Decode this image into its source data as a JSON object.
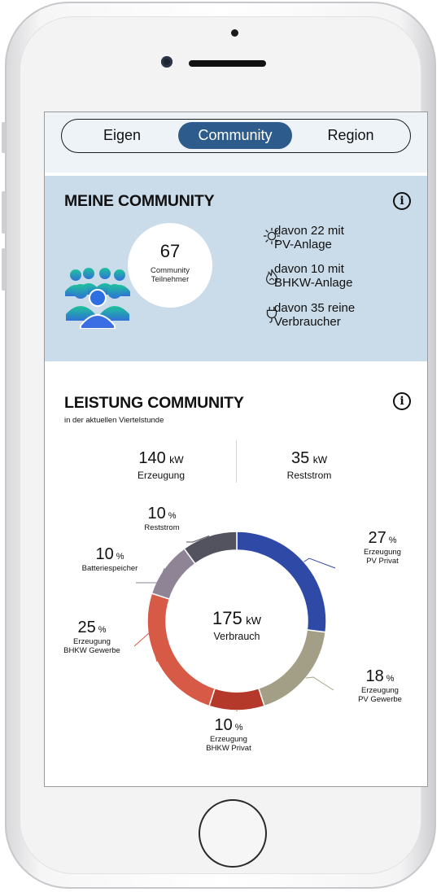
{
  "tabs": [
    {
      "label": "Eigen",
      "active": false
    },
    {
      "label": "Community",
      "active": true
    },
    {
      "label": "Region",
      "active": false
    }
  ],
  "community": {
    "title": "MEINE COMMUNITY",
    "count": "67",
    "count_label_1": "Community",
    "count_label_2": "Teilnehmer",
    "stats": [
      {
        "icon": "sun-icon",
        "line1": "davon 22 mit",
        "line2": "PV-Anlage"
      },
      {
        "icon": "flame-icon",
        "line1": "davon 10 mit",
        "line2": "BHKW-Anlage"
      },
      {
        "icon": "plug-icon",
        "line1": "davon 35 reine",
        "line2": "Verbraucher"
      }
    ]
  },
  "leistung": {
    "title": "LEISTUNG COMMUNITY",
    "subtitle": "in der aktuellen Viertelstunde",
    "erzeugung_value": "140",
    "erzeugung_unit": "kW",
    "erzeugung_label": "Erzeugung",
    "reststrom_value": "35",
    "reststrom_unit": "kW",
    "reststrom_label": "Reststrom",
    "center_value": "175",
    "center_unit": "kW",
    "center_label": "Verbrauch"
  },
  "chart_data": {
    "type": "pie",
    "donut": true,
    "slices": [
      {
        "label_1": "Erzeugung",
        "label_2": "PV Privat",
        "value": 27,
        "color": "#2f4aa6"
      },
      {
        "label_1": "Erzeugung",
        "label_2": "PV Gewerbe",
        "value": 18,
        "color": "#a29f86"
      },
      {
        "label_1": "Erzeugung",
        "label_2": "BHKW Privat",
        "value": 10,
        "color": "#b5392a"
      },
      {
        "label_1": "Erzeugung",
        "label_2": "BHKW Gewerbe",
        "value": 25,
        "color": "#d65a45"
      },
      {
        "label_1": "Batteriespeicher",
        "label_2": "",
        "value": 10,
        "color": "#8e8496"
      },
      {
        "label_1": "Reststrom",
        "label_2": "",
        "value": 10,
        "color": "#53535f"
      }
    ],
    "unit": "%"
  }
}
